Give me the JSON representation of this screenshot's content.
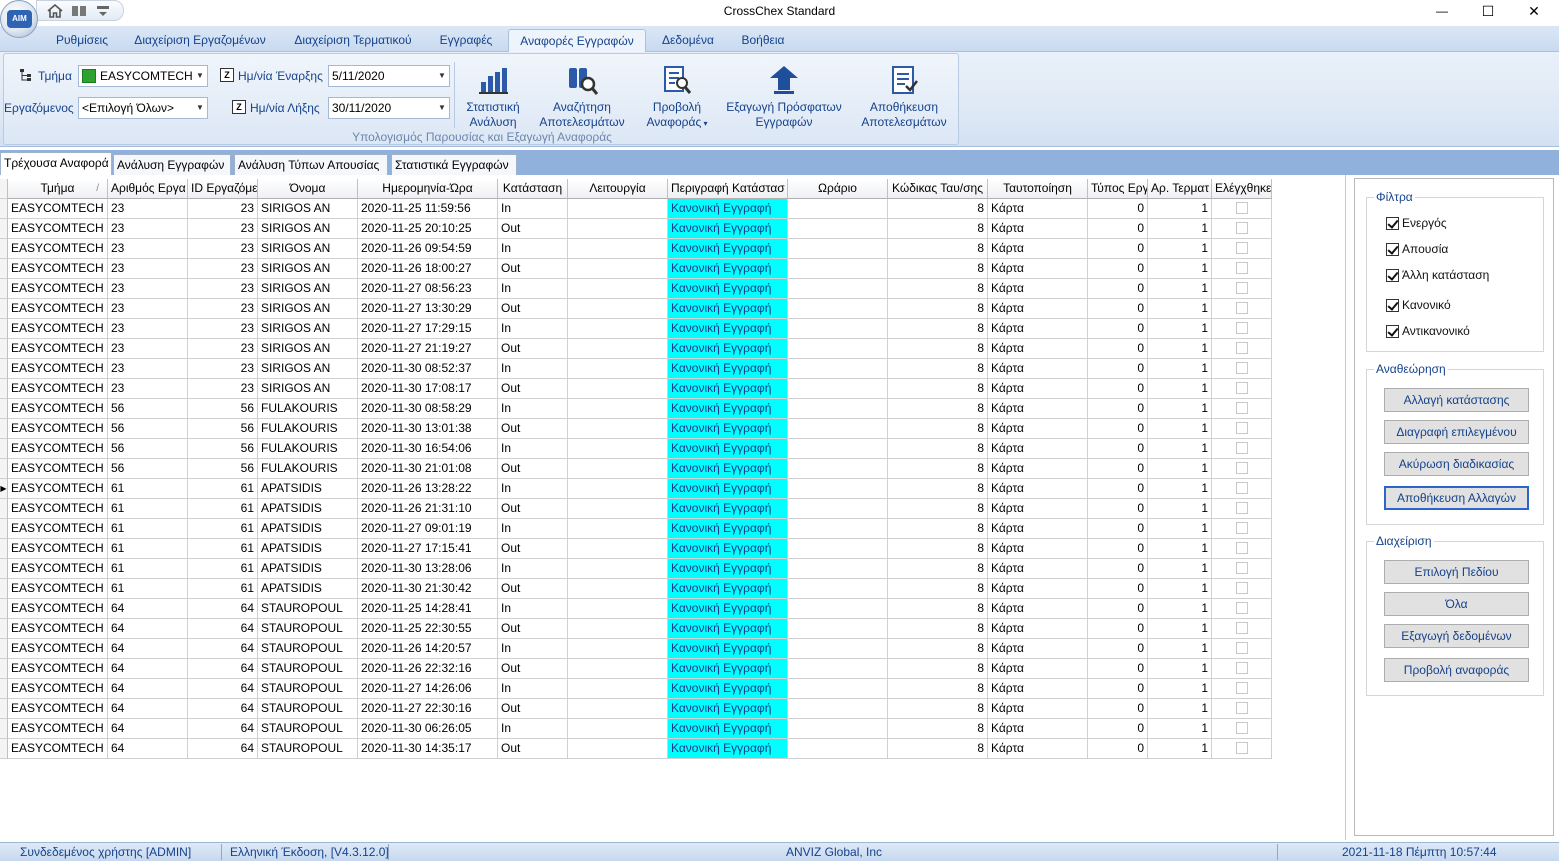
{
  "window": {
    "title": "CrossChex Standard",
    "minimize_glyph": "—",
    "maximize_glyph": "☐",
    "close_glyph": "✕",
    "logo_text": "AIM"
  },
  "ribbon": {
    "tabs": [
      {
        "label": "Ρυθμίσεις"
      },
      {
        "label": "Διαχείριση Εργαζομένων"
      },
      {
        "label": "Διαχείριση Τερματικού"
      },
      {
        "label": "Εγγραφές"
      },
      {
        "label": "Αναφορές Εγγραφών"
      },
      {
        "label": "Δεδομένα"
      },
      {
        "label": "Βοήθεια"
      }
    ],
    "active_tab": "Αναφορές Εγγραφών",
    "department_label": "Τμήμα",
    "department_value": "EASYCOMTECH",
    "employee_label": "Εργαζόμενος",
    "employee_value": "<Επιλογή Όλων>",
    "start_date_label": "Ημ/νία Έναρξης",
    "start_date_value": "5/11/2020",
    "end_date_label": "Ημ/νία Λήξης",
    "end_date_value": "30/11/2020",
    "buttons": [
      {
        "line1": "Στατιστική",
        "line2": "Ανάλυση",
        "icon": "bar-chart-icon"
      },
      {
        "line1": "Αναζήτηση",
        "line2": "Αποτελεσμάτων",
        "icon": "binoculars-search-icon"
      },
      {
        "line1": "Προβολή",
        "line2": "Αναφοράς",
        "icon": "report-view-icon"
      },
      {
        "line1": "Εξαγωγή Πρόσφατων",
        "line2": "Εγγραφών",
        "icon": "export-arrow-icon"
      },
      {
        "line1": "Αποθήκευση",
        "line2": "Αποτελεσμάτων",
        "icon": "save-document-icon"
      }
    ],
    "group_caption": "Υπολογισμός Παρουσίας και Εξαγωγή Αναφοράς"
  },
  "subtabs": [
    {
      "label": "Τρέχουσα Αναφορά"
    },
    {
      "label": "Ανάλυση Εγγραφών"
    },
    {
      "label": "Ανάλυση Τύπων Απουσίας"
    },
    {
      "label": "Στατιστικά Εγγραφών"
    }
  ],
  "grid": {
    "columns": [
      "Τμήμα",
      "Αριθμός Εργα",
      "ID Εργαζόμε",
      "Όνομα",
      "Ημερομηνία-Ώρα",
      "Κατάσταση",
      "Λειτουργία",
      "Περιγραφή Κατάστασ",
      "Ωράριο",
      "Κώδικας Ταυ/σης",
      "Ταυτοποίηση",
      "Τύπος Εργ",
      "Αρ. Τερματ",
      "Ελέγχθηκε"
    ],
    "current_row_marker": "▶",
    "rows": [
      [
        "EASYCOMTECH",
        "23",
        "23",
        "SIRIGOS AN",
        "2020-11-25 11:59:56",
        "In",
        "",
        "Κανονική Εγγραφή",
        "",
        "8",
        "Κάρτα",
        "0",
        "1"
      ],
      [
        "EASYCOMTECH",
        "23",
        "23",
        "SIRIGOS AN",
        "2020-11-25 20:10:25",
        "Out",
        "",
        "Κανονική Εγγραφή",
        "",
        "8",
        "Κάρτα",
        "0",
        "1"
      ],
      [
        "EASYCOMTECH",
        "23",
        "23",
        "SIRIGOS AN",
        "2020-11-26 09:54:59",
        "In",
        "",
        "Κανονική Εγγραφή",
        "",
        "8",
        "Κάρτα",
        "0",
        "1"
      ],
      [
        "EASYCOMTECH",
        "23",
        "23",
        "SIRIGOS AN",
        "2020-11-26 18:00:27",
        "Out",
        "",
        "Κανονική Εγγραφή",
        "",
        "8",
        "Κάρτα",
        "0",
        "1"
      ],
      [
        "EASYCOMTECH",
        "23",
        "23",
        "SIRIGOS AN",
        "2020-11-27 08:56:23",
        "In",
        "",
        "Κανονική Εγγραφή",
        "",
        "8",
        "Κάρτα",
        "0",
        "1"
      ],
      [
        "EASYCOMTECH",
        "23",
        "23",
        "SIRIGOS AN",
        "2020-11-27 13:30:29",
        "Out",
        "",
        "Κανονική Εγγραφή",
        "",
        "8",
        "Κάρτα",
        "0",
        "1"
      ],
      [
        "EASYCOMTECH",
        "23",
        "23",
        "SIRIGOS AN",
        "2020-11-27 17:29:15",
        "In",
        "",
        "Κανονική Εγγραφή",
        "",
        "8",
        "Κάρτα",
        "0",
        "1"
      ],
      [
        "EASYCOMTECH",
        "23",
        "23",
        "SIRIGOS AN",
        "2020-11-27 21:19:27",
        "Out",
        "",
        "Κανονική Εγγραφή",
        "",
        "8",
        "Κάρτα",
        "0",
        "1"
      ],
      [
        "EASYCOMTECH",
        "23",
        "23",
        "SIRIGOS AN",
        "2020-11-30 08:52:37",
        "In",
        "",
        "Κανονική Εγγραφή",
        "",
        "8",
        "Κάρτα",
        "0",
        "1"
      ],
      [
        "EASYCOMTECH",
        "23",
        "23",
        "SIRIGOS AN",
        "2020-11-30 17:08:17",
        "Out",
        "",
        "Κανονική Εγγραφή",
        "",
        "8",
        "Κάρτα",
        "0",
        "1"
      ],
      [
        "EASYCOMTECH",
        "56",
        "56",
        "FULAKOURIS",
        "2020-11-30 08:58:29",
        "In",
        "",
        "Κανονική Εγγραφή",
        "",
        "8",
        "Κάρτα",
        "0",
        "1"
      ],
      [
        "EASYCOMTECH",
        "56",
        "56",
        "FULAKOURIS",
        "2020-11-30 13:01:38",
        "Out",
        "",
        "Κανονική Εγγραφή",
        "",
        "8",
        "Κάρτα",
        "0",
        "1"
      ],
      [
        "EASYCOMTECH",
        "56",
        "56",
        "FULAKOURIS",
        "2020-11-30 16:54:06",
        "In",
        "",
        "Κανονική Εγγραφή",
        "",
        "8",
        "Κάρτα",
        "0",
        "1"
      ],
      [
        "EASYCOMTECH",
        "56",
        "56",
        "FULAKOURIS",
        "2020-11-30 21:01:08",
        "Out",
        "",
        "Κανονική Εγγραφή",
        "",
        "8",
        "Κάρτα",
        "0",
        "1"
      ],
      [
        "EASYCOMTECH",
        "61",
        "61",
        "APATSIDIS",
        "2020-11-26 13:28:22",
        "In",
        "",
        "Κανονική Εγγραφή",
        "",
        "8",
        "Κάρτα",
        "0",
        "1"
      ],
      [
        "EASYCOMTECH",
        "61",
        "61",
        "APATSIDIS",
        "2020-11-26 21:31:10",
        "Out",
        "",
        "Κανονική Εγγραφή",
        "",
        "8",
        "Κάρτα",
        "0",
        "1"
      ],
      [
        "EASYCOMTECH",
        "61",
        "61",
        "APATSIDIS",
        "2020-11-27 09:01:19",
        "In",
        "",
        "Κανονική Εγγραφή",
        "",
        "8",
        "Κάρτα",
        "0",
        "1"
      ],
      [
        "EASYCOMTECH",
        "61",
        "61",
        "APATSIDIS",
        "2020-11-27 17:15:41",
        "Out",
        "",
        "Κανονική Εγγραφή",
        "",
        "8",
        "Κάρτα",
        "0",
        "1"
      ],
      [
        "EASYCOMTECH",
        "61",
        "61",
        "APATSIDIS",
        "2020-11-30 13:28:06",
        "In",
        "",
        "Κανονική Εγγραφή",
        "",
        "8",
        "Κάρτα",
        "0",
        "1"
      ],
      [
        "EASYCOMTECH",
        "61",
        "61",
        "APATSIDIS",
        "2020-11-30 21:30:42",
        "Out",
        "",
        "Κανονική Εγγραφή",
        "",
        "8",
        "Κάρτα",
        "0",
        "1"
      ],
      [
        "EASYCOMTECH",
        "64",
        "64",
        "STAUROPOUL",
        "2020-11-25 14:28:41",
        "In",
        "",
        "Κανονική Εγγραφή",
        "",
        "8",
        "Κάρτα",
        "0",
        "1"
      ],
      [
        "EASYCOMTECH",
        "64",
        "64",
        "STAUROPOUL",
        "2020-11-25 22:30:55",
        "Out",
        "",
        "Κανονική Εγγραφή",
        "",
        "8",
        "Κάρτα",
        "0",
        "1"
      ],
      [
        "EASYCOMTECH",
        "64",
        "64",
        "STAUROPOUL",
        "2020-11-26 14:20:57",
        "In",
        "",
        "Κανονική Εγγραφή",
        "",
        "8",
        "Κάρτα",
        "0",
        "1"
      ],
      [
        "EASYCOMTECH",
        "64",
        "64",
        "STAUROPOUL",
        "2020-11-26 22:32:16",
        "Out",
        "",
        "Κανονική Εγγραφή",
        "",
        "8",
        "Κάρτα",
        "0",
        "1"
      ],
      [
        "EASYCOMTECH",
        "64",
        "64",
        "STAUROPOUL",
        "2020-11-27 14:26:06",
        "In",
        "",
        "Κανονική Εγγραφή",
        "",
        "8",
        "Κάρτα",
        "0",
        "1"
      ],
      [
        "EASYCOMTECH",
        "64",
        "64",
        "STAUROPOUL",
        "2020-11-27 22:30:16",
        "Out",
        "",
        "Κανονική Εγγραφή",
        "",
        "8",
        "Κάρτα",
        "0",
        "1"
      ],
      [
        "EASYCOMTECH",
        "64",
        "64",
        "STAUROPOUL",
        "2020-11-30 06:26:05",
        "In",
        "",
        "Κανονική Εγγραφή",
        "",
        "8",
        "Κάρτα",
        "0",
        "1"
      ],
      [
        "EASYCOMTECH",
        "64",
        "64",
        "STAUROPOUL",
        "2020-11-30 14:35:17",
        "Out",
        "",
        "Κανονική Εγγραφή",
        "",
        "8",
        "Κάρτα",
        "0",
        "1"
      ]
    ],
    "highlight_color": "#00ffff"
  },
  "panel": {
    "filters_title": "Φίλτρα",
    "filters": [
      {
        "label": "Ενεργός",
        "checked": true
      },
      {
        "label": "Απουσία",
        "checked": true
      },
      {
        "label": "Άλλη κατάσταση",
        "checked": true
      },
      {
        "label": "Κανονικό",
        "checked": true
      },
      {
        "label": "Αντικανονικό",
        "checked": true
      }
    ],
    "review_title": "Αναθεώρηση",
    "review_buttons": [
      "Αλλαγή κατάστασης",
      "Διαγραφή επιλεγμένου",
      "Ακύρωση διαδικασίας",
      "Αποθήκευση Αλλαγών"
    ],
    "manage_title": "Διαχείριση",
    "manage_buttons": [
      "Επιλογή Πεδίου",
      "Όλα",
      "Εξαγωγή δεδομένων",
      "Προβολή αναφοράς"
    ]
  },
  "status": {
    "user": "Συνδεδεμένος χρήστης [ADMIN]",
    "version": "Ελληνική Έκδοση, [V4.3.12.0]",
    "company": "ANVIZ Global, Inc",
    "datetime": "2021-11-18 Πέμπτη 10:57:44"
  },
  "colors": {
    "ribbon_text": "#15428b",
    "highlight": "#00ffff",
    "department_swatch": "#2ea22e"
  }
}
